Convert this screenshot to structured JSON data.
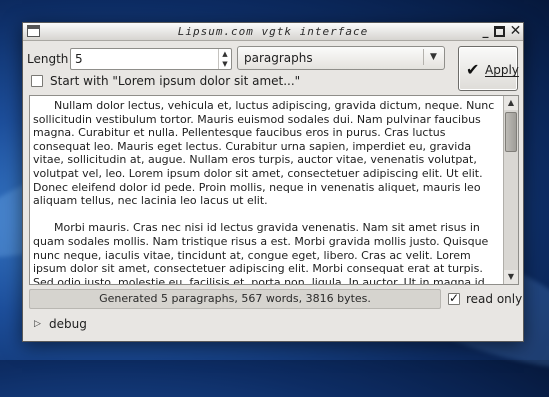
{
  "window": {
    "title": "Lipsum.com vgtk interface"
  },
  "controls": {
    "length_label": "Length",
    "length_value": "5",
    "unit_selected": "paragraphs",
    "start_with_label": "Start with \"Lorem ipsum dolor sit amet...\"",
    "start_with_checked": false,
    "apply_label": "Apply"
  },
  "text": {
    "content": "      Nullam dolor lectus, vehicula et, luctus adipiscing, gravida dictum, neque. Nunc sollicitudin vestibulum tortor. Mauris euismod sodales dui. Nam pulvinar faucibus magna. Curabitur et nulla. Pellentesque faucibus eros in purus. Cras luctus consequat leo. Mauris eget lectus. Curabitur urna sapien, imperdiet eu, gravida vitae, sollicitudin at, augue. Nullam eros turpis, auctor vitae, venenatis volutpat, volutpat vel, leo. Lorem ipsum dolor sit amet, consectetuer adipiscing elit. Ut elit. Donec eleifend dolor id pede. Proin mollis, neque in venenatis aliquet, mauris leo aliquam tellus, nec lacinia leo lacus ut elit.\n\n      Morbi mauris. Cras nec nisi id lectus gravida venenatis. Nam sit amet risus in quam sodales mollis. Nam tristique risus a est. Morbi gravida mollis justo. Quisque nunc neque, iaculis vitae, tincidunt at, congue eget, libero. Cras ac velit. Lorem ipsum dolor sit amet, consectetuer adipiscing elit. Morbi consequat erat at turpis. Sed odio justo, molestie eu, facilisis et, porta non, ligula. In auctor. Ut in magna id magna accumsan molestie. Pellentesque lobortis. Ut nulla."
  },
  "status": {
    "message": "Generated 5 paragraphs, 567 words, 3816 bytes.",
    "read_only_label": "read only",
    "read_only_checked": true
  },
  "debug": {
    "label": "debug"
  },
  "icons": {
    "apply": "checkmark-icon",
    "expander": "triangle-right-icon"
  },
  "colors": {
    "window_bg": "#e8e6e3",
    "desktop_bg": "#1d4f9c"
  }
}
